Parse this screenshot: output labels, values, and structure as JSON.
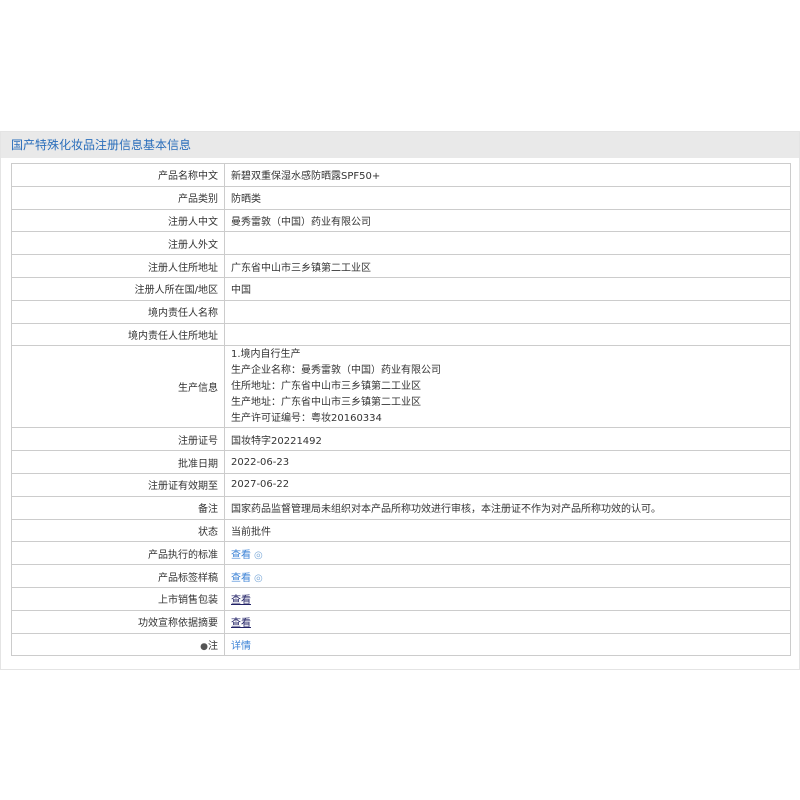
{
  "header": {
    "title": "国产特殊化妆品注册信息基本信息"
  },
  "rows": [
    {
      "label": "产品名称中文",
      "value": "新碧双重保湿水感防晒露SPF50+"
    },
    {
      "label": "产品类别",
      "value": "防晒类"
    },
    {
      "label": "注册人中文",
      "value": "曼秀雷敦（中国）药业有限公司"
    },
    {
      "label": "注册人外文",
      "value": ""
    },
    {
      "label": "注册人住所地址",
      "value": "广东省中山市三乡镇第二工业区"
    },
    {
      "label": "注册人所在国/地区",
      "value": "中国"
    },
    {
      "label": "境内责任人名称",
      "value": ""
    },
    {
      "label": "境内责任人住所地址",
      "value": ""
    }
  ],
  "production": {
    "label": "生产信息",
    "lines": [
      "1.境内自行生产",
      "生产企业名称：曼秀雷敦（中国）药业有限公司",
      "住所地址：广东省中山市三乡镇第二工业区",
      "生产地址：广东省中山市三乡镇第二工业区",
      "生产许可证编号：粤妆20160334"
    ]
  },
  "rows2": [
    {
      "label": "注册证号",
      "value": "国妆特字20221492"
    },
    {
      "label": "批准日期",
      "value": "2022-06-23"
    },
    {
      "label": "注册证有效期至",
      "value": "2027-06-22"
    },
    {
      "label": "备注",
      "value": "国家药品监督管理局未组织对本产品所称功效进行审核，本注册证不作为对产品所称功效的认可。"
    },
    {
      "label": "状态",
      "value": "当前批件"
    }
  ],
  "links": {
    "standard": {
      "label": "产品执行的标准",
      "text": "查看"
    },
    "label_sample": {
      "label": "产品标签样稿",
      "text": "查看"
    },
    "sales_package": {
      "label": "上市销售包装",
      "text": "查看"
    },
    "efficacy": {
      "label": "功效宣称依据摘要",
      "text": "查看"
    },
    "note": {
      "label": "注",
      "text": "详情"
    }
  },
  "icons": {
    "eye": "eye-icon",
    "pin": "map-pin-icon"
  },
  "colors": {
    "header_text": "#2a6ebb",
    "header_bg": "#e9e9e9",
    "link": "#3b82d6",
    "border": "#cccccc"
  }
}
